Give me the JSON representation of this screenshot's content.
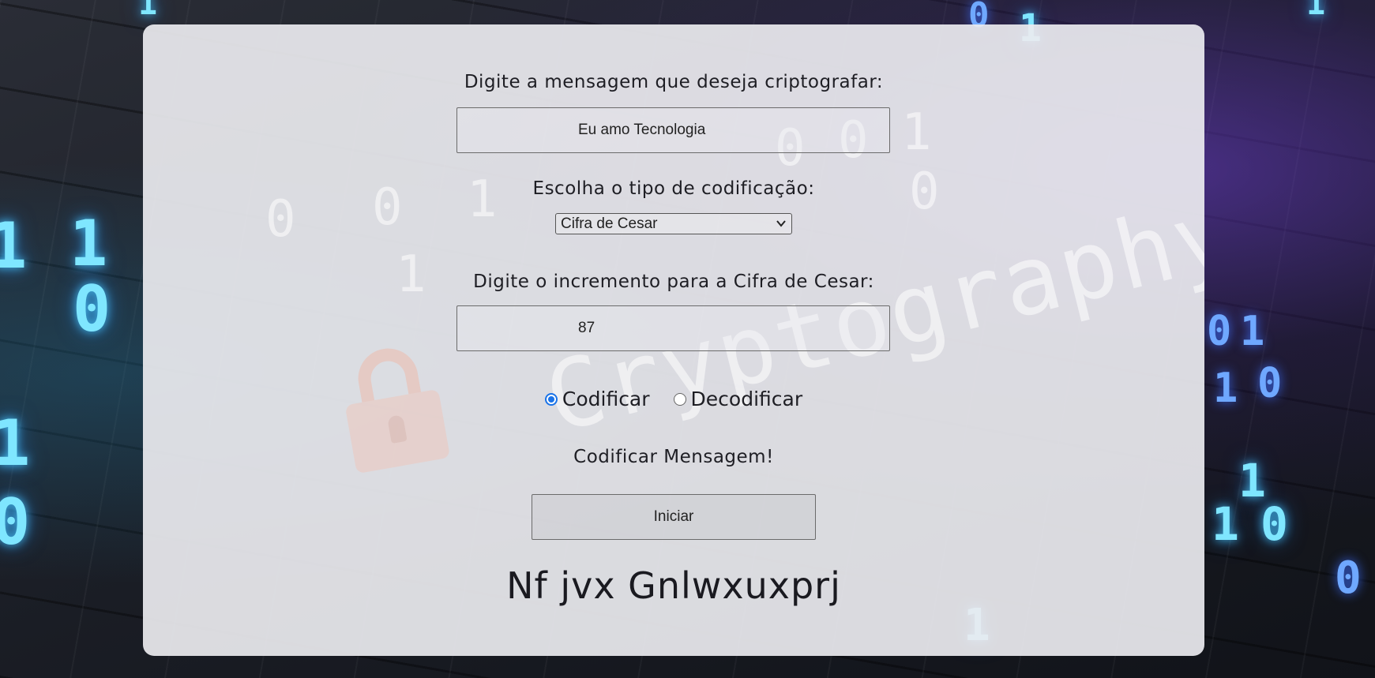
{
  "background": {
    "decor_digits": [
      "1",
      "1",
      "0",
      "1",
      "0",
      "1",
      "0",
      "1",
      "1",
      "0",
      "1",
      "0",
      "1",
      "0",
      "1",
      "0",
      "1",
      "1"
    ],
    "card_watermark": {
      "word": "Cryptography",
      "digits": [
        "0",
        "0",
        "1",
        "1",
        "0",
        "0",
        "1",
        "0"
      ]
    }
  },
  "form": {
    "message_label": "Digite a mensagem que deseja criptografar:",
    "message_value": "Eu amo Tecnologia",
    "encoding_label": "Escolha o tipo de codificação:",
    "encoding_selected": "Cifra de Cesar",
    "increment_label": "Digite o incremento para a Cifra de Cesar:",
    "increment_value": "87",
    "radio_encode": "Codificar",
    "radio_decode": "Decodificar",
    "action_title": "Codificar Mensagem!",
    "start_button": "Iniciar",
    "result": "Nf jvx Gnlwxuxprj"
  },
  "colors": {
    "radio_accent": "#1a73e8",
    "card_bg": "#ececf0",
    "text": "#1e1e24"
  },
  "icons": {
    "select_arrow": "chevron-down-icon",
    "watermark_lock": "lock-icon"
  }
}
